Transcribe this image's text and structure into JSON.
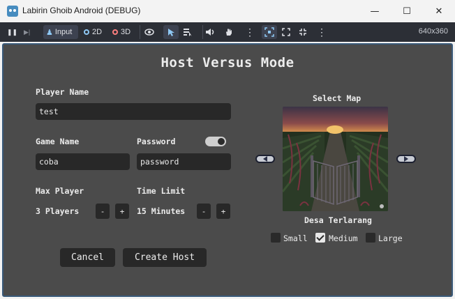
{
  "window": {
    "title": "Labirin Ghoib Android (DEBUG)",
    "minimize_glyph": "—",
    "maximize_glyph": "☐",
    "close_glyph": "✕"
  },
  "toolbar": {
    "pause_glyph": "❚❚",
    "next_frame_glyph": "▶|",
    "input_label": "Input",
    "mode_2d": "2D",
    "mode_3d": "3D",
    "more_glyph": "⋮",
    "resolution": "640x360",
    "colors": {
      "accent": "#478cbf",
      "mode_2d": "#8fc9f5",
      "mode_3d": "#fc7f7f"
    }
  },
  "screen": {
    "title": "Host Versus Mode",
    "player_name": {
      "label": "Player Name",
      "value": "test"
    },
    "game_name": {
      "label": "Game Name",
      "value": "coba"
    },
    "password": {
      "label": "Password",
      "value": "password",
      "toggle_on": true
    },
    "max_player": {
      "label": "Max Player",
      "value": "3 Players"
    },
    "time_limit": {
      "label": "Time Limit",
      "value": "15 Minutes"
    },
    "stepper": {
      "minus": "-",
      "plus": "+"
    },
    "cancel_label": "Cancel",
    "create_label": "Create Host"
  },
  "map": {
    "label": "Select Map",
    "name": "Desa Terlarang",
    "sizes": [
      {
        "label": "Small",
        "checked": false
      },
      {
        "label": "Medium",
        "checked": true
      },
      {
        "label": "Large",
        "checked": false
      }
    ]
  }
}
